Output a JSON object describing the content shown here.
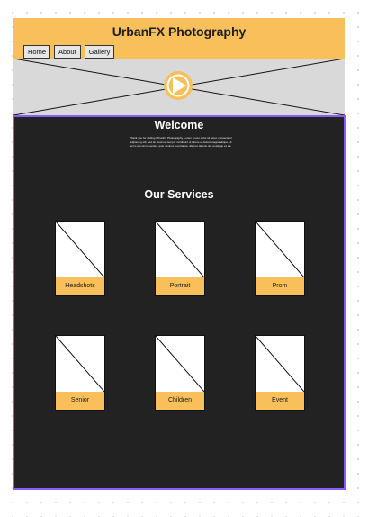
{
  "header": {
    "title": "UrbanFX Photography",
    "nav": [
      "Home",
      "About",
      "Gallery"
    ]
  },
  "hero": {
    "play_icon": "play-icon"
  },
  "main": {
    "welcome_title": "Welcome",
    "intro_text": "Thank you for visiting UrbanFX Photography. Lorem ipsum dolor sit amet, consectetur adipiscing elit, sed do eiusmod tempor incididunt ut labore et dolore magna aliqua. Ut enim ad minim veniam, quis nostrud exercitation ullamco laboris nisi ut aliquip ex ea.",
    "services_title": "Our Services",
    "services": [
      "Headshots",
      "Portrait",
      "Prom",
      "Senior",
      "Children",
      "Event"
    ]
  },
  "colors": {
    "accent": "#f8bf5a",
    "main_bg": "#222222",
    "selection_border": "#8b5cf6",
    "hero_placeholder": "#d9d9d9"
  }
}
